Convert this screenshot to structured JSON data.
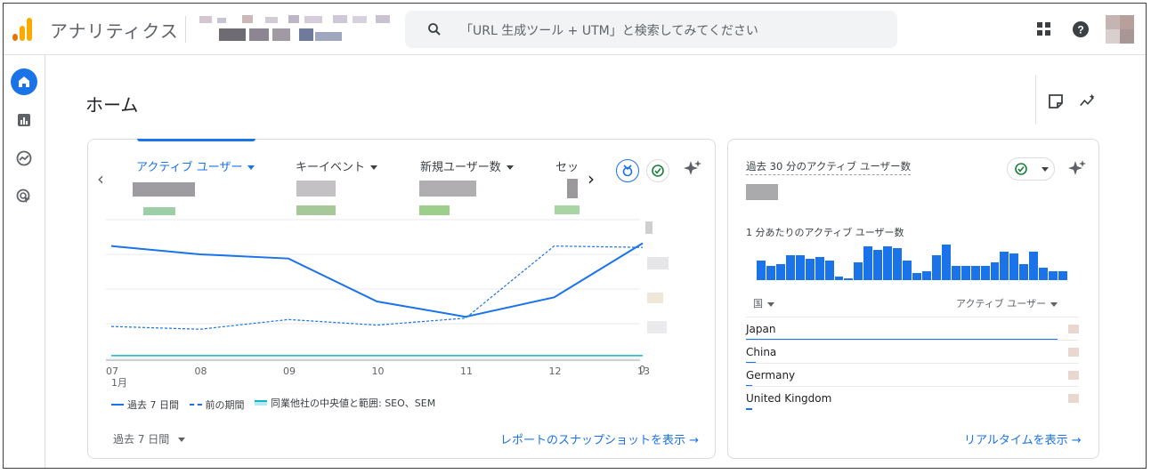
{
  "app": {
    "title": "アナリティクス"
  },
  "search": {
    "placeholder": "「URL 生成ツール + UTM」と検索してみてください"
  },
  "colors": {
    "accent": "#1a73e8",
    "logo_orange": "#f9ab00",
    "logo_dark": "#e37400",
    "benchmark": "#12b5cb"
  },
  "icons": {
    "apps": "apps-grid-icon",
    "help": "help-icon",
    "home": "home-icon",
    "reports": "reports-icon",
    "explore": "explore-icon",
    "advertising": "advertising-icon"
  },
  "page": {
    "title": "ホーム"
  },
  "overview": {
    "metrics": [
      "アクティブ ユーザー",
      "キーイベント",
      "新規ユーザー数",
      "セッ"
    ],
    "x_ticks": [
      "07",
      "08",
      "09",
      "10",
      "11",
      "12",
      "13"
    ],
    "x_month": "1月",
    "y_zero": "0",
    "legend": [
      "過去 7 日間",
      "前の期間",
      "同業他社の中央値と範囲: SEO、SEM"
    ],
    "date_range": "過去 7 日間",
    "link": "レポートのスナップショットを表示 →"
  },
  "realtime": {
    "title": "過去 30 分のアクティブ ユーザー数",
    "subtitle": "1 分あたりのアクティブ ユーザー数",
    "col_country": "国",
    "col_users": "アクティブ ユーザー",
    "countries": [
      {
        "name": "Japan",
        "share": 1.0
      },
      {
        "name": "China",
        "share": 0.03
      },
      {
        "name": "Germany",
        "share": 0.02
      },
      {
        "name": "United Kingdom",
        "share": 0.02
      }
    ],
    "per_minute_relative": [
      0.55,
      0.4,
      0.45,
      0.7,
      0.7,
      0.6,
      0.65,
      0.55,
      0.1,
      0.05,
      0.5,
      0.95,
      0.85,
      0.95,
      0.9,
      0.55,
      0.2,
      0.25,
      0.7,
      1.0,
      0.4,
      0.4,
      0.4,
      0.4,
      0.5,
      0.8,
      0.75,
      0.45,
      0.8,
      0.35,
      0.25,
      0.25
    ],
    "link": "リアルタイムを表示 →"
  },
  "chart_data": {
    "type": "line",
    "x": [
      "07",
      "08",
      "09",
      "10",
      "11",
      "12",
      "13"
    ],
    "xlabel": "1月",
    "series": [
      {
        "name": "過去 7 日間",
        "relative": [
          0.81,
          0.75,
          0.72,
          0.41,
          0.3,
          0.44,
          0.83
        ]
      },
      {
        "name": "前の期間",
        "relative": [
          0.23,
          0.21,
          0.28,
          0.24,
          0.29,
          0.81,
          0.8
        ]
      },
      {
        "name": "同業他社の中央値と範囲: SEO、SEM",
        "relative": [
          0.02,
          0.02,
          0.02,
          0.02,
          0.02,
          0.02,
          0.02
        ]
      }
    ],
    "ylim_min": 0,
    "grid": true,
    "legend": "bottom"
  }
}
